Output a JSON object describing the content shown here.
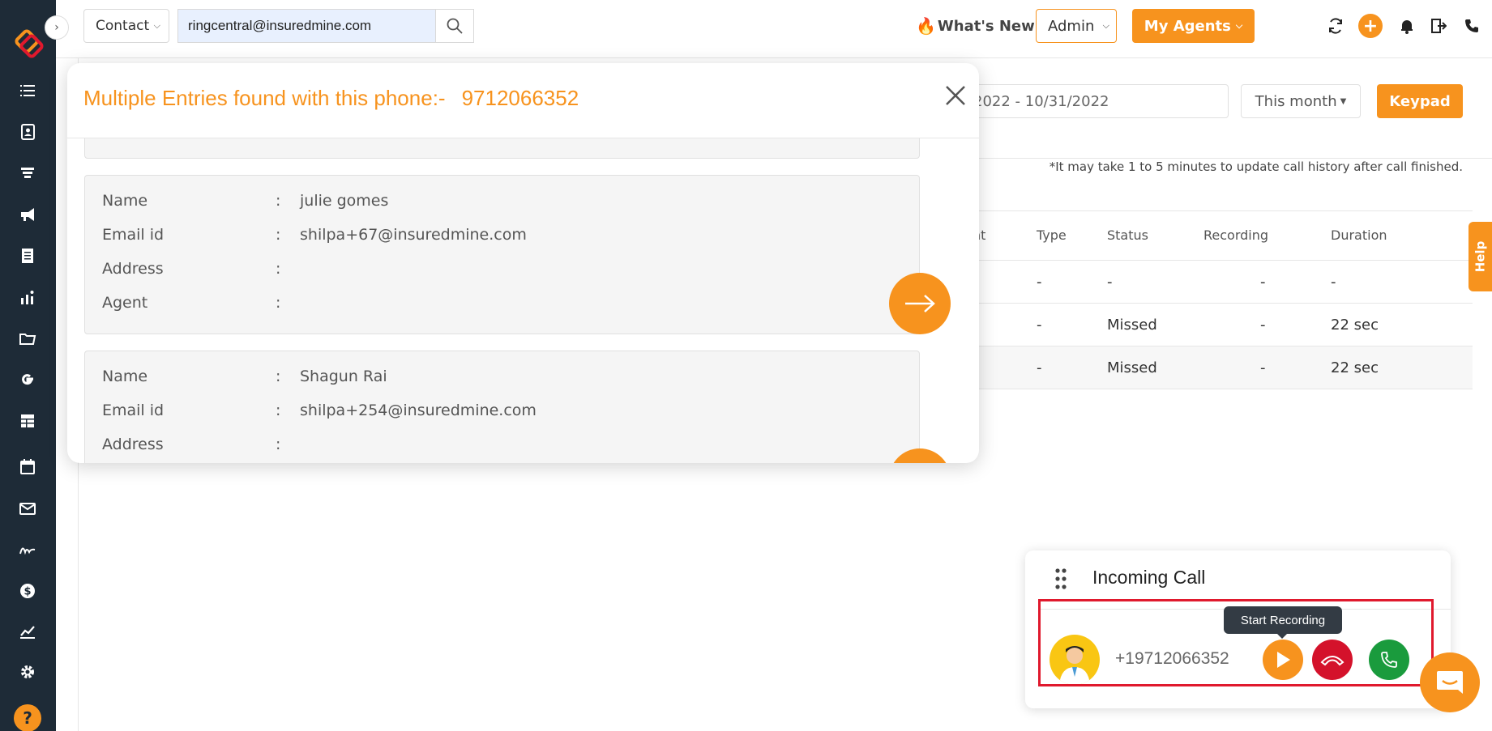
{
  "topbar": {
    "contact_select": "Contact",
    "search_value": "ringcentral@insuredmine.com",
    "whats_new": "What's New",
    "admin_select": "Admin",
    "my_agents": "My Agents"
  },
  "filters": {
    "date_range": "2022 - 10/31/2022",
    "this_month": "This month",
    "keypad": "Keypad"
  },
  "note": "*It may take 1 to 5 minutes to update call history after call finished.",
  "table": {
    "headers": [
      "nt",
      "Type",
      "Status",
      "Recording",
      "Duration"
    ],
    "rows": [
      [
        "-",
        "-",
        "-",
        "-"
      ],
      [
        "-",
        "Missed",
        "-",
        "22 sec"
      ],
      [
        "-",
        "Missed",
        "-",
        "22 sec"
      ]
    ]
  },
  "help_tab": "Help",
  "modal": {
    "title": "Multiple Entries found with this phone:-",
    "phone": "9712066352",
    "separator": ":",
    "labels": {
      "name": "Name",
      "email": "Email id",
      "address": "Address",
      "agent": "Agent"
    },
    "entries": [
      {
        "name": "julie gomes",
        "email": "shilpa+67@insuredmine.com",
        "address": "",
        "agent": ""
      },
      {
        "name": "Shagun Rai",
        "email": "shilpa+254@insuredmine.com",
        "address": ""
      }
    ]
  },
  "call": {
    "title": "Incoming Call",
    "number": "+19712066352",
    "tooltip": "Start Recording"
  },
  "colors": {
    "accent": "#f7931e",
    "sidebar": "#1e2b37",
    "decline": "#d4122b",
    "accept": "#1a9b3d",
    "highlight": "#e0192d"
  }
}
